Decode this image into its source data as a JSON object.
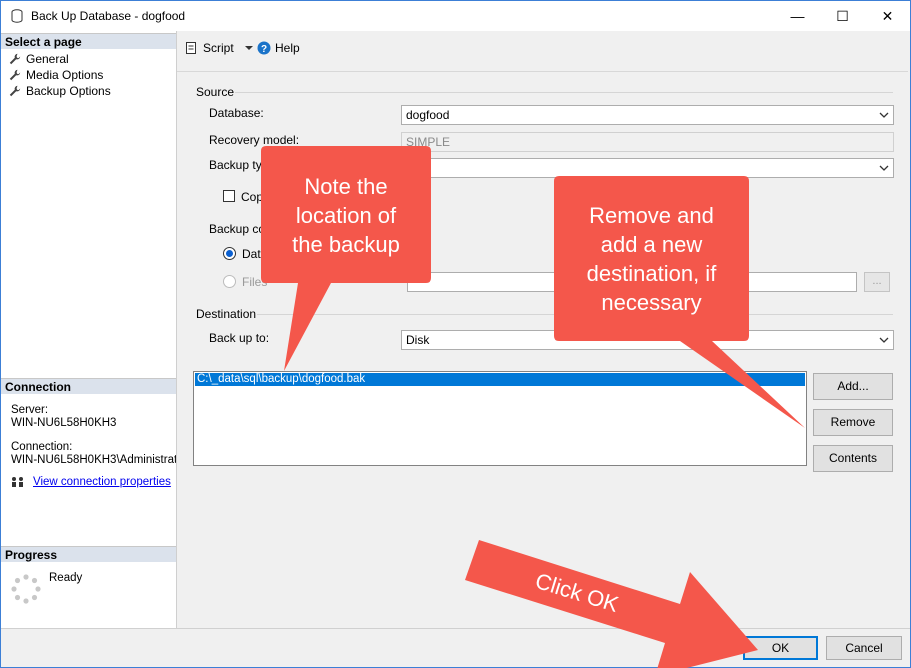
{
  "window": {
    "title": "Back Up Database - dogfood",
    "controls": {
      "minimize": "—",
      "maximize": "☐",
      "close": "✕"
    }
  },
  "left_pane": {
    "select_page": {
      "header": "Select a page",
      "items": [
        {
          "label": "General",
          "icon": "wrench-icon"
        },
        {
          "label": "Media Options",
          "icon": "wrench-icon"
        },
        {
          "label": "Backup Options",
          "icon": "wrench-icon"
        }
      ]
    },
    "connection": {
      "header": "Connection",
      "server_label": "Server:",
      "server_value": "WIN-NU6L58H0KH3",
      "connection_label": "Connection:",
      "connection_value": "WIN-NU6L58H0KH3\\Administrator",
      "view_properties_link": "View connection properties"
    },
    "progress": {
      "header": "Progress",
      "status": "Ready"
    }
  },
  "toolbar": {
    "script_label": "Script",
    "help_label": "Help"
  },
  "source": {
    "group_label": "Source",
    "database_label": "Database:",
    "database_value": "dogfood",
    "recovery_model_label": "Recovery model:",
    "recovery_model_value": "SIMPLE",
    "backup_type_label": "Backup typ",
    "copy_only_label": "Cop",
    "backup_component_label": "Backup co",
    "component_database_label": "Data",
    "component_files_label": "Files"
  },
  "destination": {
    "group_label": "Destination",
    "back_up_to_label": "Back up to:",
    "back_up_to_value": "Disk",
    "paths": [
      "C:\\_data\\sql\\backup\\dogfood.bak"
    ],
    "add_button": "Add...",
    "remove_button": "Remove",
    "contents_button": "Contents"
  },
  "footer": {
    "ok_button": "OK",
    "cancel_button": "Cancel"
  },
  "annotations": {
    "note_location": [
      "Note the",
      "location of",
      "the backup"
    ],
    "remove_and_add": [
      "Remove and",
      "add a new",
      "destination, if",
      "necessary"
    ],
    "click_ok": "Click OK",
    "color": "#f4574b"
  }
}
